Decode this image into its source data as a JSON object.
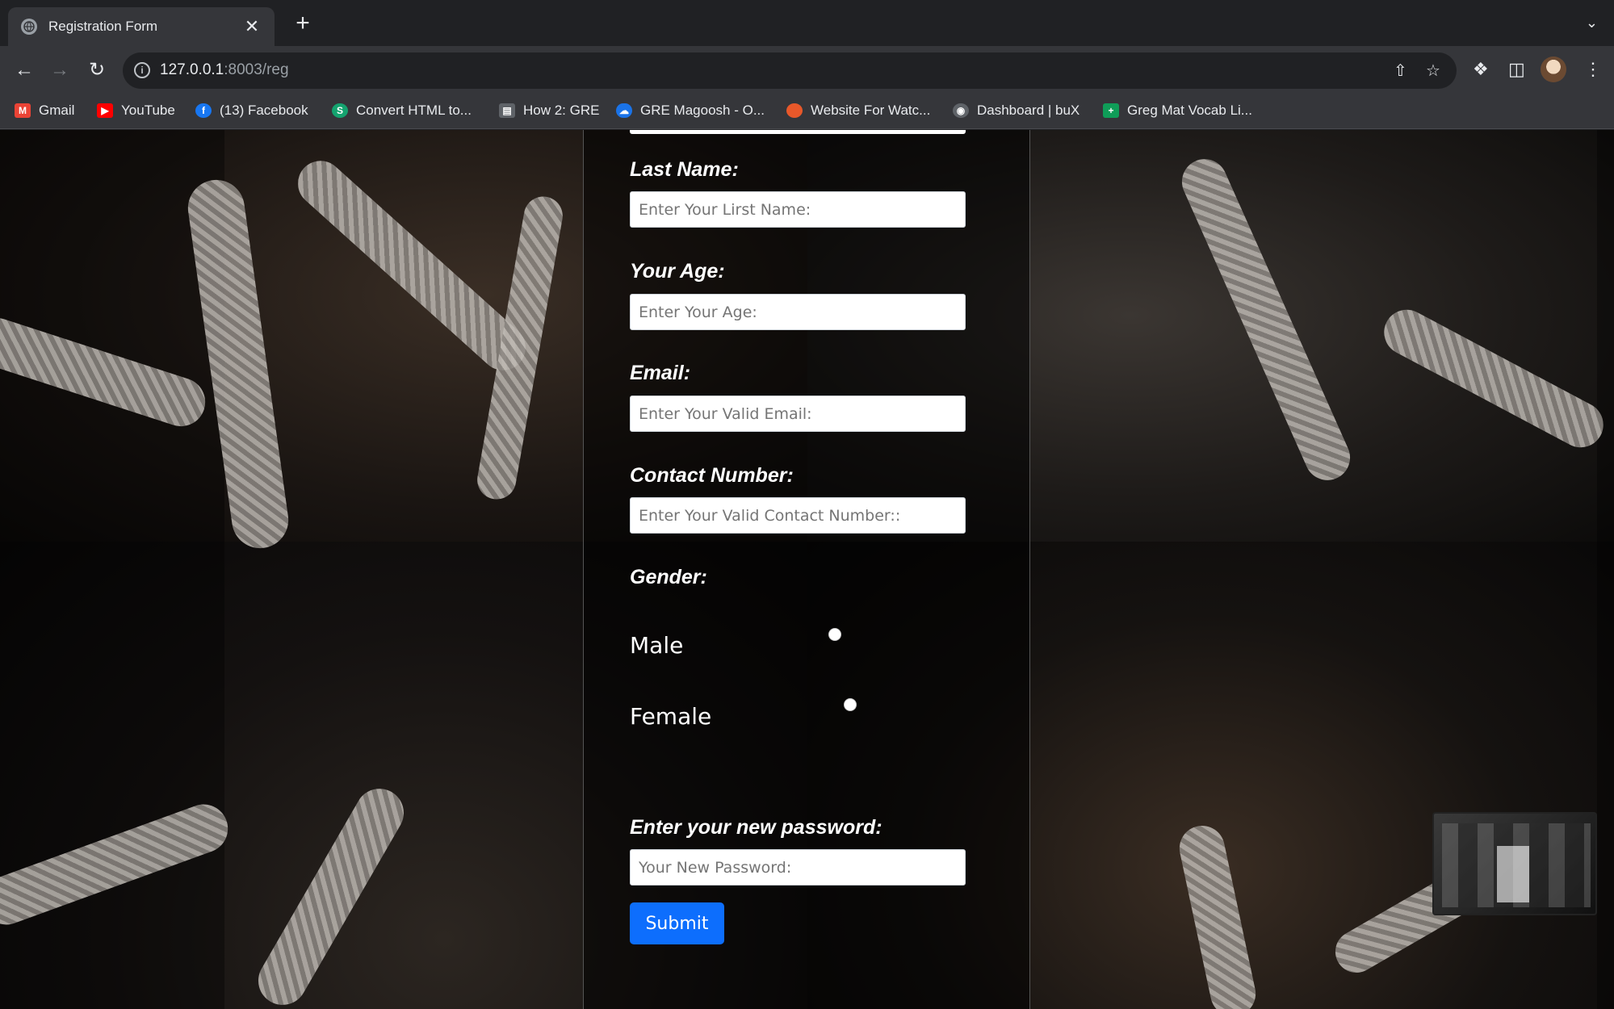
{
  "browser": {
    "tab_title": "Registration Form",
    "tab_close": "✕",
    "new_tab": "+",
    "tab_menu": "⌄",
    "url_host": "127.0.0.1",
    "url_rest": ":8003/reg"
  },
  "bookmarks": [
    {
      "label": "Gmail",
      "icon": "gmail-icon",
      "color": "#ea4335"
    },
    {
      "label": "YouTube",
      "icon": "youtube-icon",
      "color": "#ff0000"
    },
    {
      "label": "(13) Facebook",
      "icon": "facebook-icon",
      "color": "#1877f2"
    },
    {
      "label": "Convert HTML to...",
      "icon": "convert-icon",
      "color": "#14a36f"
    },
    {
      "label": "How 2: GRE",
      "icon": "document-icon",
      "color": "#9aa0a6"
    },
    {
      "label": "GRE Magoosh - O...",
      "icon": "cloud-icon",
      "color": "#1a73e8"
    },
    {
      "label": "Website For Watc...",
      "icon": "website-icon",
      "color": "#e8582a"
    },
    {
      "label": "Dashboard | buX",
      "icon": "dashboard-icon",
      "color": "#9aa0a6"
    },
    {
      "label": "Greg Mat Vocab Li...",
      "icon": "sheets-icon",
      "color": "#0f9d58"
    }
  ],
  "form": {
    "last_name_label": "Last Name:",
    "last_name_placeholder": "Enter Your Lirst Name:",
    "age_label": "Your Age:",
    "age_placeholder": "Enter Your Age:",
    "email_label": "Email:",
    "email_placeholder": "Enter Your Valid Email:",
    "contact_label": "Contact Number:",
    "contact_placeholder": "Enter Your Valid Contact Number::",
    "gender_label": "Gender:",
    "male_label": "Male",
    "female_label": "Female",
    "password_label": "Enter your new password:",
    "password_placeholder": "Your New Password:",
    "submit_label": "Submit"
  },
  "colors": {
    "submit": "#0d6efd",
    "chrome_bg": "#202124",
    "toolbar_bg": "#35363a"
  }
}
